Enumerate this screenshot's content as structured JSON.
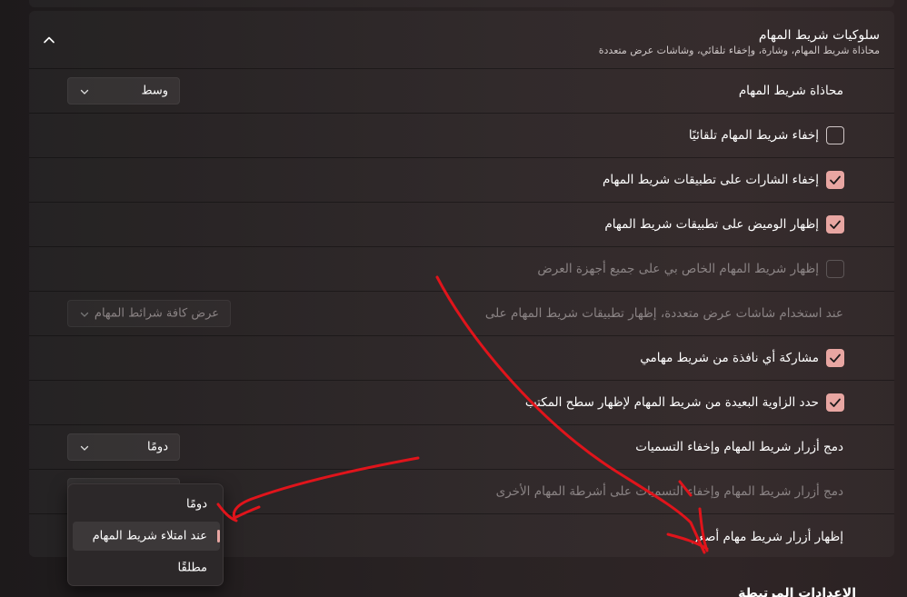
{
  "section": {
    "title": "سلوكيات شريط المهام",
    "subtitle": "محاذاة شريط المهام، وشارة، وإخفاء تلقائي، وشاشات عرض متعددة",
    "collapse_icon": "chevron-up-icon"
  },
  "rows": {
    "alignment": {
      "label": "محاذاة شريط المهام",
      "value": "وسط"
    },
    "auto_hide": {
      "label": "إخفاء شريط المهام تلقائيًا",
      "checked": false
    },
    "hide_badges": {
      "label": "إخفاء الشارات على تطبيقات شريط المهام",
      "checked": true
    },
    "show_flashing": {
      "label": "إظهار الوميض على تطبيقات شريط المهام",
      "checked": true
    },
    "all_displays": {
      "label": "إظهار شريط المهام الخاص بي على جميع أجهزة العرض",
      "checked": false,
      "disabled": true
    },
    "multi_display": {
      "label": "عند استخدام شاشات عرض متعددة، إظهار تطبيقات شريط المهام على",
      "value": "عرض كافة شرائط المهام",
      "disabled": true
    },
    "share_window": {
      "label": "مشاركة أي نافذة من شريط مهامي",
      "checked": true
    },
    "far_corner": {
      "label": "حدد الزاوية البعيدة من شريط المهام لإظهار سطح المكتب",
      "checked": true
    },
    "combine": {
      "label": "دمج أزرار شريط المهام وإخفاء التسميات",
      "value": "دومًا"
    },
    "combine_other": {
      "label": "دمج أزرار شريط المهام وإخفاء التسميات على أشرطة المهام الأخرى",
      "disabled": true
    },
    "smaller_buttons": {
      "label": "إظهار أزرار شريط مهام أصغر"
    }
  },
  "flyout": {
    "options": [
      "دومًا",
      "عند امتلاء شريط المهام",
      "مطلقًا"
    ],
    "selected_index": 1
  },
  "next_section": {
    "title": "الإعدادات المرتبطة"
  },
  "colors": {
    "accent": "#e8a6a2",
    "annotation": "#e0141b"
  }
}
